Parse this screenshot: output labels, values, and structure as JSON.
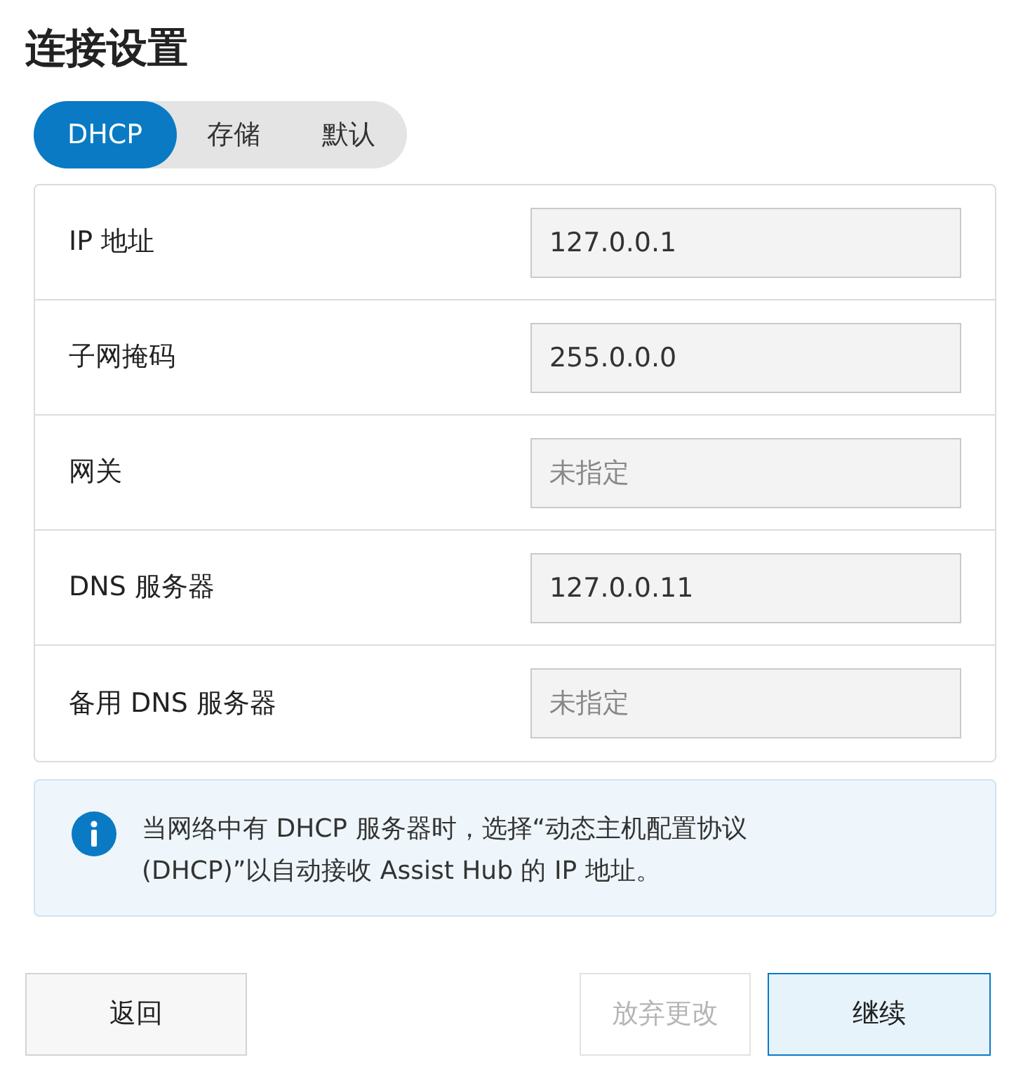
{
  "title": "连接设置",
  "tabs": [
    {
      "label": "DHCP",
      "selected": true
    },
    {
      "label": "存储",
      "selected": false
    },
    {
      "label": "默认",
      "selected": false
    }
  ],
  "fields": [
    {
      "label": "IP 地址",
      "value": "127.0.0.1"
    },
    {
      "label": "子网掩码",
      "value": "255.0.0.0"
    },
    {
      "label": "网关",
      "placeholder": "未指定"
    },
    {
      "label": "DNS 服务器",
      "value": "127.0.0.11"
    },
    {
      "label": "备用 DNS 服务器",
      "placeholder": "未指定"
    }
  ],
  "info": "当网络中有 DHCP 服务器时，选择“动态主机配置协议 (DHCP)”以自动接收 Assist Hub 的 IP 地址。",
  "buttons": {
    "back": {
      "label": "返回",
      "disabled": false
    },
    "discard": {
      "label": "放弃更改",
      "disabled": true
    },
    "continue": {
      "label": "继续",
      "disabled": false
    }
  }
}
